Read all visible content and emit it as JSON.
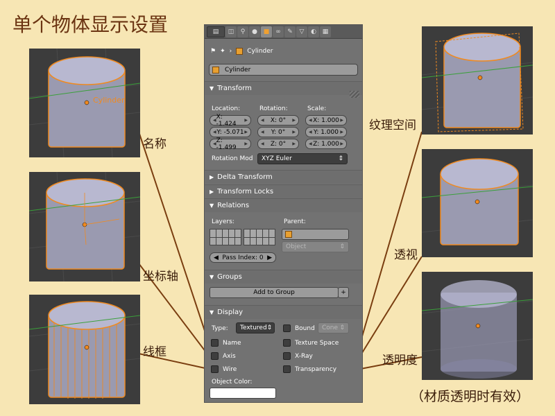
{
  "page_title": "单个物体显示设置",
  "labels": {
    "name": "名称",
    "axis": "坐标轴",
    "wire": "线框",
    "texture_space": "纹理空间",
    "xray": "透视",
    "transparency": "透明度",
    "transparency_note": "（材质透明时有效）"
  },
  "viewport_object_name": "Cylinder",
  "panel": {
    "breadcrumb": "Cylinder",
    "object_name": "Cylinder",
    "transform": {
      "title": "Transform",
      "location_label": "Location:",
      "rotation_label": "Rotation:",
      "scale_label": "Scale:",
      "loc_x": "X: -1.424",
      "loc_y": "Y: -5.071",
      "loc_z": "Z: -1.499",
      "rot_x": "X: 0°",
      "rot_y": "Y: 0°",
      "rot_z": "Z: 0°",
      "scale_x": "X: 1.000",
      "scale_y": "Y: 1.000",
      "scale_z": "Z: 1.000",
      "rotation_mode_label": "Rotation Mod",
      "rotation_mode_value": "XYZ Euler"
    },
    "delta_transform": "Delta Transform",
    "transform_locks": "Transform Locks",
    "relations": {
      "title": "Relations",
      "layers_label": "Layers:",
      "parent_label": "Parent:",
      "parent_type": "Object",
      "pass_index": "Pass Index: 0"
    },
    "groups": {
      "title": "Groups",
      "add_button": "Add to Group",
      "plus": "+"
    },
    "display": {
      "title": "Display",
      "type_label": "Type:",
      "type_value": "Textured",
      "bound_label": "Bound",
      "bound_value": "Cone",
      "name": "Name",
      "axis": "Axis",
      "wire": "Wire",
      "texture_space": "Texture Space",
      "xray": "X-Ray",
      "transparency": "Transparency",
      "object_color_label": "Object Color:",
      "object_color": "#ffffff"
    }
  },
  "colors": {
    "background": "#f7e6b4",
    "title": "#6b3412",
    "callout_line": "#7a3e10",
    "selection": "#f08a20",
    "viewport_bg": "#3c3c3c"
  }
}
